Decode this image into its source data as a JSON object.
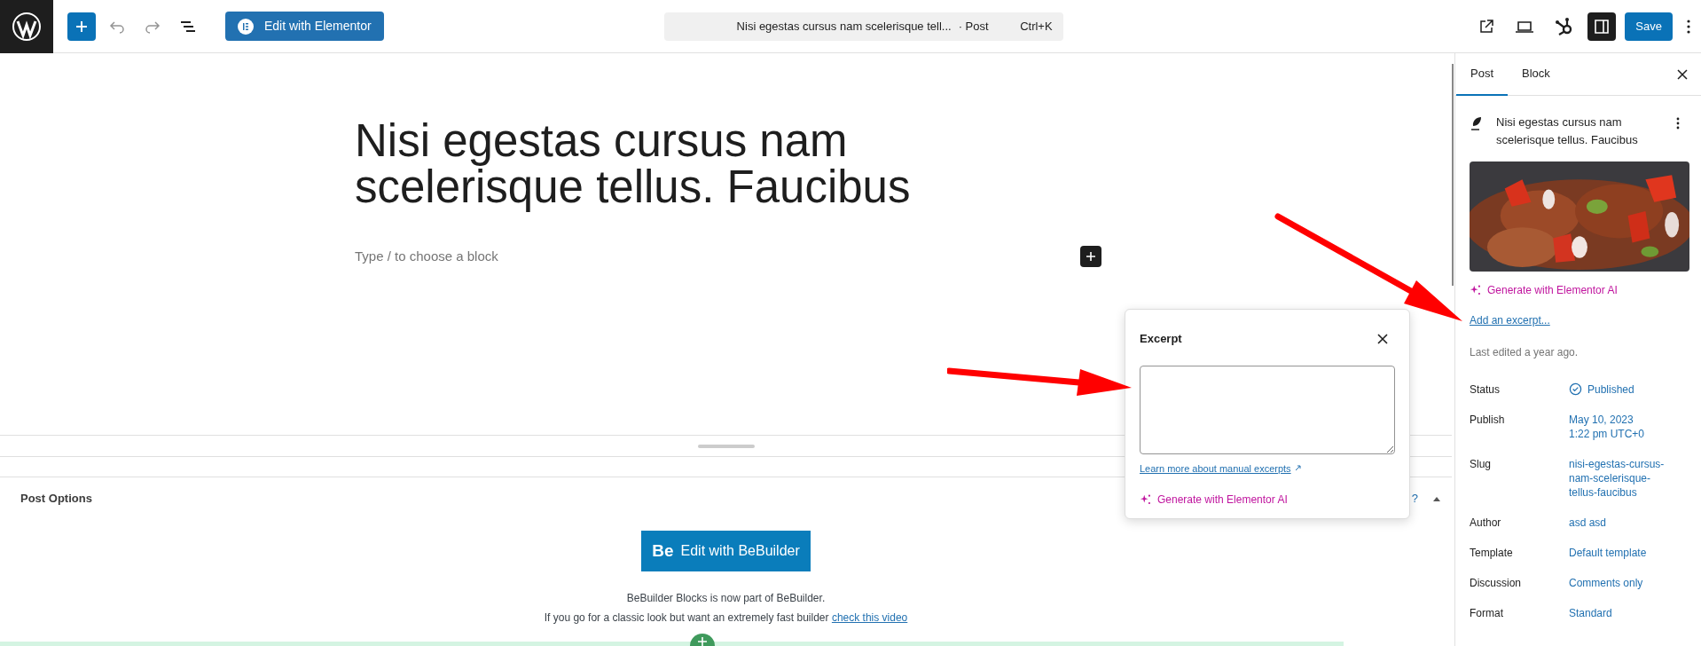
{
  "top_bar": {
    "edit_elementor_button": "Edit with Elementor",
    "command_bar": {
      "title": "Nisi egestas cursus nam scelerisque tell...",
      "type": "· Post",
      "shortcut": "Ctrl+K"
    },
    "sidebar_toggle": {
      "selected": true
    },
    "save_button": "Save"
  },
  "editor": {
    "title": "Nisi egestas cursus nam scelerisque tellus. Faucibus",
    "placeholder": "Type / to choose a block"
  },
  "post_options": {
    "title": "Post Options",
    "help": "?",
    "bebuilder_button": {
      "logo": "Be",
      "label": "Edit with BeBuilder"
    },
    "notice_line": "BeBuilder Blocks is now part of BeBuilder.",
    "notice_text": "If you go for a classic look but want an extremely fast builder",
    "notice_link": "check this video"
  },
  "excerpt_popover": {
    "title": "Excerpt",
    "learn_more": "Learn more about manual excerpts",
    "generate": "Generate with Elementor AI"
  },
  "sidebar": {
    "tabs": [
      {
        "label": "Post",
        "selected": true
      },
      {
        "label": "Block",
        "selected": false
      }
    ],
    "post_title": "Nisi egestas cursus nam scelerisque tellus. Faucibus",
    "generate": "Generate with Elementor AI",
    "add_excerpt": "Add an excerpt...",
    "last_edited": "Last edited a year ago.",
    "fields": [
      {
        "label": "Status",
        "kind": "status",
        "lines": [
          "Published"
        ]
      },
      {
        "label": "Publish",
        "kind": "text",
        "lines": [
          "May 10, 2023",
          "1:22 pm UTC+0"
        ]
      },
      {
        "label": "Slug",
        "kind": "text",
        "lines": [
          "nisi-egestas-cursus-",
          "nam-scelerisque-",
          "tellus-faucibus"
        ]
      },
      {
        "label": "Author",
        "kind": "text",
        "lines": [
          "asd asd"
        ]
      },
      {
        "label": "Template",
        "kind": "text",
        "lines": [
          "Default template"
        ]
      },
      {
        "label": "Discussion",
        "kind": "text",
        "lines": [
          "Comments only"
        ]
      },
      {
        "label": "Format",
        "kind": "text",
        "lines": [
          "Standard"
        ]
      }
    ]
  }
}
